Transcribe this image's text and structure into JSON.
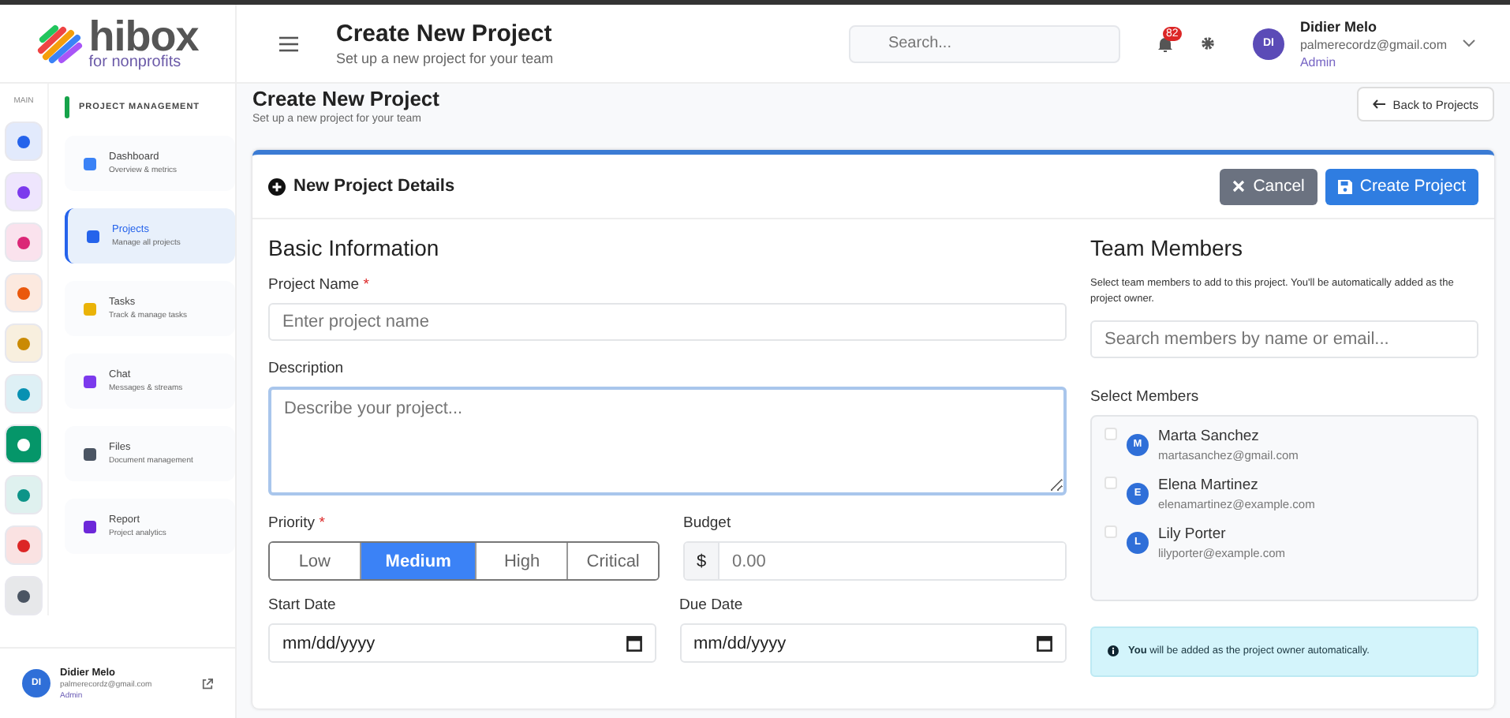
{
  "logo": {
    "name": "hibox",
    "tagline": "for nonprofits"
  },
  "header": {
    "title": "Create New Project",
    "subtitle": "Set up a new project for your team",
    "search": {
      "placeholder": "Search..."
    },
    "notifications": "82",
    "user": {
      "initials": "DI",
      "name": "Didier Melo",
      "email": "palmerecordz@gmail.com",
      "role": "Admin"
    }
  },
  "rail": {
    "label": "MAIN",
    "items": [
      {
        "color": "#2563eb",
        "selected": false
      },
      {
        "color": "#7c3aed",
        "selected": false
      },
      {
        "color": "#db2777",
        "selected": false
      },
      {
        "color": "#ea580c",
        "selected": false
      },
      {
        "color": "#ca8a04",
        "selected": false
      },
      {
        "color": "#0891b2",
        "selected": false
      },
      {
        "color": "#059669",
        "selected": true
      },
      {
        "color": "#0d9488",
        "selected": false
      },
      {
        "color": "#dc2626",
        "selected": false
      },
      {
        "color": "#4b5563",
        "selected": false
      }
    ]
  },
  "menu": {
    "title": "PROJECT MANAGEMENT",
    "items": [
      {
        "label": "Dashboard",
        "sub": "Overview & metrics",
        "selected": false,
        "color": "#3b82f6"
      },
      {
        "label": "Projects",
        "sub": "Manage all projects",
        "selected": true,
        "color": "#2563eb"
      },
      {
        "label": "Tasks",
        "sub": "Track & manage tasks",
        "selected": false,
        "color": "#eab308"
      },
      {
        "label": "Chat",
        "sub": "Messages & streams",
        "selected": false,
        "color": "#7c3aed"
      },
      {
        "label": "Files",
        "sub": "Document management",
        "selected": false,
        "color": "#4b5563"
      },
      {
        "label": "Report",
        "sub": "Project analytics",
        "selected": false,
        "color": "#6d28d9"
      }
    ]
  },
  "sidebar_user": {
    "initials": "DI",
    "name": "Didier Melo",
    "email": "palmerecordz@gmail.com",
    "role": "Admin"
  },
  "page": {
    "title": "Create New Project",
    "subtitle": "Set up a new project for your team",
    "back": "Back to Projects"
  },
  "card": {
    "title": "New Project Details",
    "cancel": "Cancel",
    "create": "Create Project",
    "basic": {
      "heading": "Basic Information",
      "name": {
        "label": "Project Name",
        "required": "*",
        "placeholder": "Enter project name"
      },
      "description": {
        "label": "Description",
        "placeholder": "Describe your project..."
      },
      "priority": {
        "label": "Priority",
        "required": "*",
        "options": [
          {
            "label": "Low",
            "selected": false
          },
          {
            "label": "Medium",
            "selected": true
          },
          {
            "label": "High",
            "selected": false
          },
          {
            "label": "Critical",
            "selected": false
          }
        ]
      },
      "budget": {
        "label": "Budget",
        "currency": "$",
        "placeholder": "0.00"
      },
      "start": {
        "label": "Start Date",
        "placeholder": "mm/dd/yyyy"
      },
      "due": {
        "label": "Due Date",
        "placeholder": "mm/dd/yyyy"
      }
    },
    "team": {
      "heading": "Team Members",
      "hint": "Select team members to add to this project. You'll be automatically added as the project owner.",
      "search": {
        "placeholder": "Search members by name or email..."
      },
      "select_label": "Select Members",
      "members": [
        {
          "initials": "M",
          "name": "Marta Sanchez",
          "email": "martasanchez@gmail.com",
          "checked": false
        },
        {
          "initials": "E",
          "name": "Elena Martinez",
          "email": "elenamartinez@example.com",
          "checked": false
        },
        {
          "initials": "L",
          "name": "Lily Porter",
          "email": "lilyporter@example.com",
          "checked": false
        }
      ],
      "note": "**You** will be added as the project owner automatically."
    }
  }
}
